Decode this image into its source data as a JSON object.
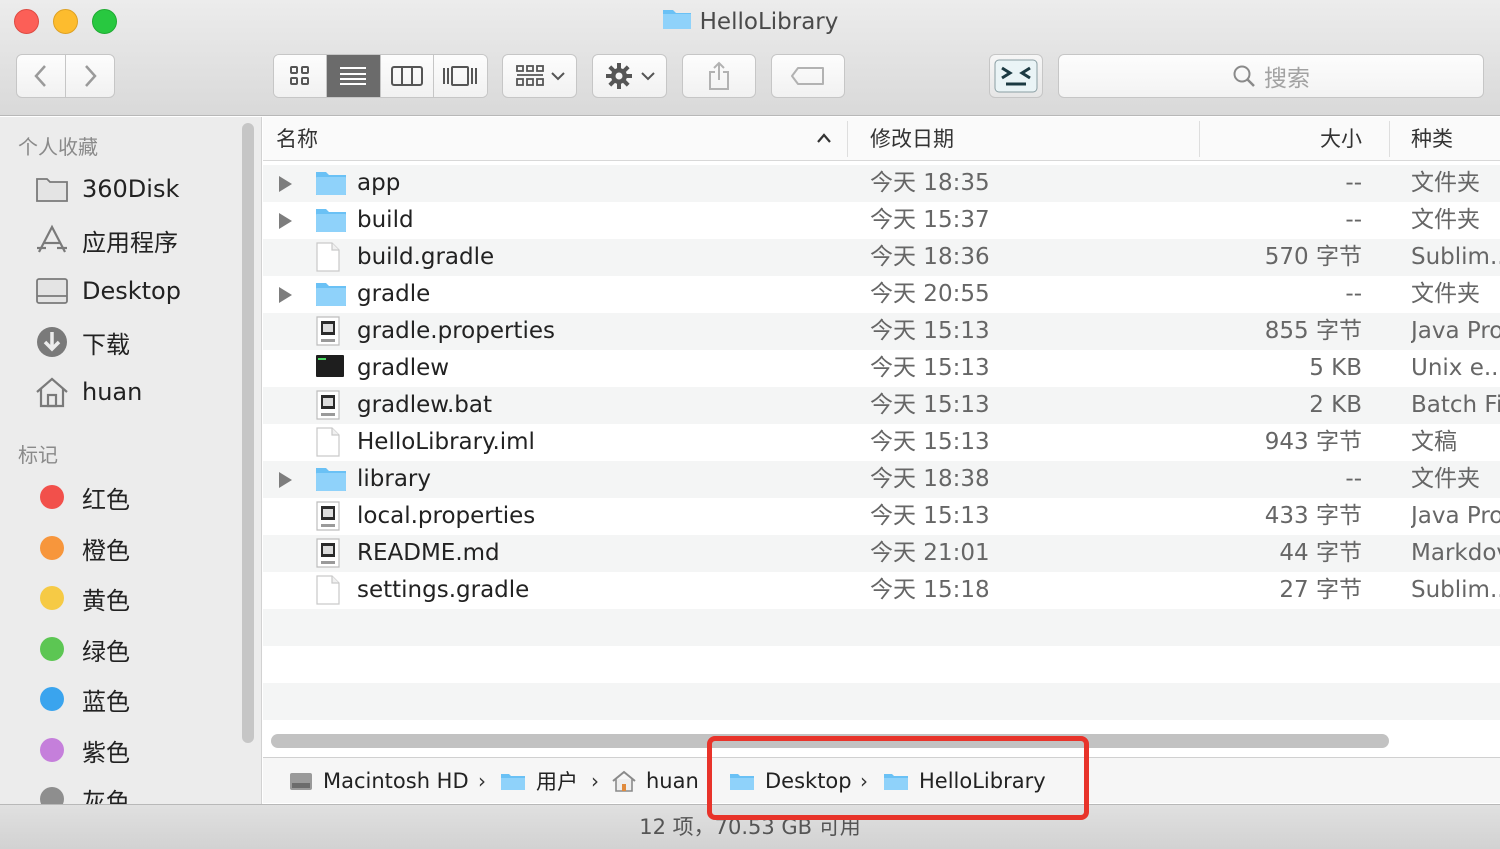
{
  "window": {
    "title": "HelloLibrary"
  },
  "toolbar": {
    "search_placeholder": "搜索",
    "view_modes": [
      "icon-view",
      "list-view",
      "column-view",
      "coverflow-view"
    ],
    "active_view": "list-view"
  },
  "sidebar": {
    "favorites_header": "个人收藏",
    "favorites": [
      {
        "label": "360Disk",
        "icon": "disk-folder-icon"
      },
      {
        "label": "应用程序",
        "icon": "applications-icon"
      },
      {
        "label": "Desktop",
        "icon": "desktop-icon"
      },
      {
        "label": "下载",
        "icon": "downloads-icon"
      },
      {
        "label": "huan",
        "icon": "home-icon"
      }
    ],
    "tags_header": "标记",
    "tags": [
      {
        "label": "红色",
        "color": "#f2504b"
      },
      {
        "label": "橙色",
        "color": "#f7963c"
      },
      {
        "label": "黄色",
        "color": "#f6ca45"
      },
      {
        "label": "绿色",
        "color": "#5cc653"
      },
      {
        "label": "蓝色",
        "color": "#3aa4ee"
      },
      {
        "label": "紫色",
        "color": "#c57fdb"
      },
      {
        "label": "灰色",
        "color": "#8e8e8e"
      }
    ]
  },
  "list": {
    "columns": {
      "name": "名称",
      "date": "修改日期",
      "size": "大小",
      "kind": "种类"
    },
    "rows": [
      {
        "name": "app",
        "date": "今天 18:35",
        "size": "--",
        "kind": "文件夹",
        "type": "folder"
      },
      {
        "name": "build",
        "date": "今天 15:37",
        "size": "--",
        "kind": "文件夹",
        "type": "folder"
      },
      {
        "name": "build.gradle",
        "date": "今天 18:36",
        "size": "570 字节",
        "kind": "Sublim...",
        "type": "doc"
      },
      {
        "name": "gradle",
        "date": "今天 20:55",
        "size": "--",
        "kind": "文件夹",
        "type": "folder"
      },
      {
        "name": "gradle.properties",
        "date": "今天 15:13",
        "size": "855 字节",
        "kind": "Java Pro",
        "type": "java"
      },
      {
        "name": "gradlew",
        "date": "今天 15:13",
        "size": "5 KB",
        "kind": "Unix e...",
        "type": "exec"
      },
      {
        "name": "gradlew.bat",
        "date": "今天 15:13",
        "size": "2 KB",
        "kind": "Batch Fi",
        "type": "java"
      },
      {
        "name": "HelloLibrary.iml",
        "date": "今天 15:13",
        "size": "943 字节",
        "kind": "文稿",
        "type": "doc"
      },
      {
        "name": "library",
        "date": "今天 18:38",
        "size": "--",
        "kind": "文件夹",
        "type": "folder"
      },
      {
        "name": "local.properties",
        "date": "今天 15:13",
        "size": "433 字节",
        "kind": "Java Pro",
        "type": "java"
      },
      {
        "name": "README.md",
        "date": "今天 21:01",
        "size": "44 字节",
        "kind": "Markdov",
        "type": "java"
      },
      {
        "name": "settings.gradle",
        "date": "今天 15:18",
        "size": "27 字节",
        "kind": "Sublim...",
        "type": "doc"
      }
    ]
  },
  "pathbar": {
    "crumbs": [
      {
        "label": "Macintosh HD",
        "icon": "hard-drive-icon"
      },
      {
        "label": "用户",
        "icon": "folder-icon"
      },
      {
        "label": "huan",
        "icon": "home-icon"
      },
      {
        "label": "Desktop",
        "icon": "folder-icon"
      },
      {
        "label": "HelloLibrary",
        "icon": "folder-icon"
      }
    ],
    "separator": "›"
  },
  "status": {
    "text": "12 项，70.53 GB 可用"
  }
}
